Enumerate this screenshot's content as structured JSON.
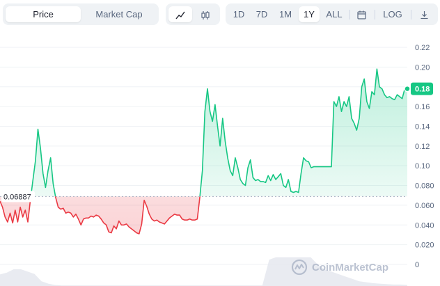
{
  "toolbar": {
    "metric_tabs": [
      {
        "label": "Price",
        "active": true
      },
      {
        "label": "Market Cap",
        "active": false
      }
    ],
    "chart_type_icons": [
      "line-chart-icon",
      "candlestick-icon"
    ],
    "ranges": [
      {
        "label": "1D",
        "active": false
      },
      {
        "label": "7D",
        "active": false
      },
      {
        "label": "1M",
        "active": false
      },
      {
        "label": "1Y",
        "active": true
      },
      {
        "label": "ALL",
        "active": false
      }
    ],
    "calendar_icon": "calendar-icon",
    "log_label": "LOG",
    "download_icon": "download-icon"
  },
  "watermark": "CoinMarketCap",
  "colors": {
    "up": "#16c784",
    "down": "#ea3943",
    "volume": "#e3e6ee",
    "grid": "#eff2f5",
    "axis_text": "#58667e"
  },
  "chart_data": {
    "type": "line",
    "reference_label": "0.06887",
    "reference_value": 0.06887,
    "current_label": "0.18",
    "ylim": [
      0,
      0.22
    ],
    "y_ticks": [
      "0.22",
      "0.20",
      "0.18",
      "0.16",
      "0.14",
      "0.12",
      "0.10",
      "0.080",
      "0.060",
      "0.040",
      "0.020",
      "0"
    ],
    "grid": true,
    "series": [
      {
        "values": [
          0.064,
          0.058,
          0.048,
          0.043,
          0.052,
          0.042,
          0.055,
          0.043,
          0.058,
          0.048,
          0.055,
          0.043,
          0.065,
          0.085,
          0.105,
          0.137,
          0.118,
          0.092,
          0.078,
          0.095,
          0.108,
          0.082,
          0.068,
          0.058,
          0.056,
          0.057,
          0.052,
          0.053,
          0.052,
          0.048,
          0.051,
          0.046,
          0.04,
          0.046,
          0.047,
          0.047,
          0.049,
          0.048,
          0.05,
          0.049,
          0.046,
          0.042,
          0.04,
          0.033,
          0.032,
          0.039,
          0.036,
          0.044,
          0.04,
          0.04,
          0.041,
          0.038,
          0.036,
          0.034,
          0.032,
          0.031,
          0.041,
          0.065,
          0.059,
          0.051,
          0.046,
          0.044,
          0.045,
          0.043,
          0.042,
          0.041,
          0.044,
          0.047,
          0.049,
          0.051,
          0.05,
          0.05,
          0.046,
          0.045,
          0.045,
          0.046,
          0.045,
          0.045,
          0.046,
          0.068,
          0.095,
          0.155,
          0.178,
          0.155,
          0.145,
          0.162,
          0.14,
          0.12,
          0.148,
          0.125,
          0.108,
          0.095,
          0.09,
          0.108,
          0.098,
          0.086,
          0.082,
          0.08,
          0.098,
          0.106,
          0.088,
          0.085,
          0.086,
          0.084,
          0.084,
          0.083,
          0.09,
          0.085,
          0.091,
          0.086,
          0.089,
          0.092,
          0.08,
          0.078,
          0.086,
          0.074,
          0.073,
          0.074,
          0.073,
          0.092,
          0.108,
          0.105,
          0.104,
          0.098,
          0.099,
          0.099,
          0.099,
          0.099,
          0.099,
          0.099,
          0.099,
          0.099,
          0.165,
          0.16,
          0.17,
          0.155,
          0.165,
          0.16,
          0.17,
          0.148,
          0.143,
          0.136,
          0.148,
          0.18,
          0.188,
          0.165,
          0.158,
          0.175,
          0.172,
          0.198,
          0.18,
          0.178,
          0.172,
          0.169,
          0.17,
          0.168,
          0.167,
          0.172,
          0.17,
          0.168,
          0.178,
          0.178
        ]
      }
    ],
    "volume": [
      0.24,
      0.28,
      0.35,
      0.35,
      0.3,
      0.25,
      0.1,
      0.05,
      0.02,
      0.01,
      0.01,
      0.01,
      0.01,
      0.01,
      0.01,
      0.01,
      0.01,
      0.01,
      0.01,
      0.01,
      0.01,
      0.01,
      0.01,
      0.01,
      0.01,
      0.01,
      0.01,
      0.01,
      0.01,
      0.01,
      0.01,
      0.01,
      0.01,
      0.01,
      0.01,
      0.01,
      0.01,
      0.01,
      0.01,
      0.55,
      0.6,
      0.6,
      0.6,
      0.6,
      0.6,
      0.6,
      0.45,
      0.35,
      0.3,
      0.25,
      0.2,
      0.15,
      0.1,
      0.08,
      0.06,
      0.05,
      0.04,
      0.03,
      0.03,
      0.02
    ]
  }
}
